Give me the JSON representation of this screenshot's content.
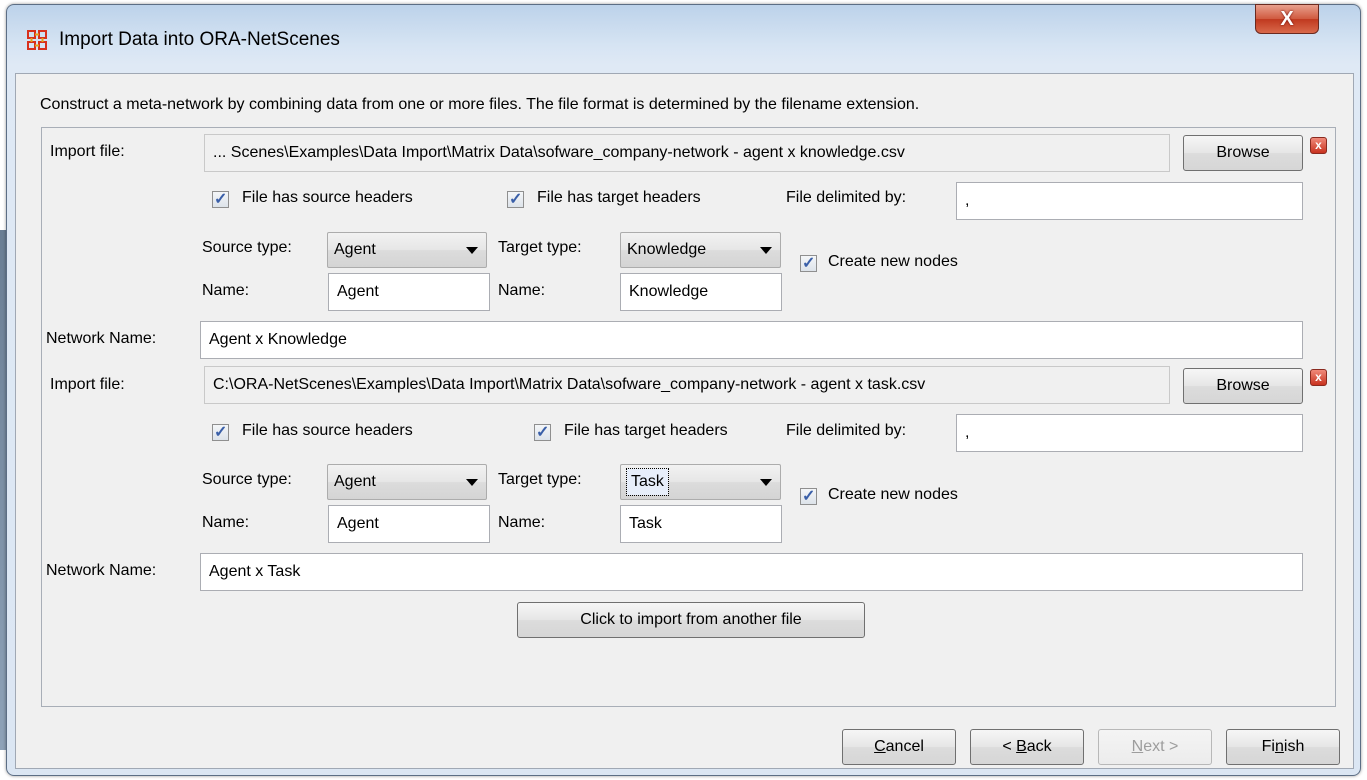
{
  "window": {
    "title": "Import Data into ORA-NetScenes",
    "close_symbol": "X"
  },
  "description": "Construct a meta-network by combining data from one or more files. The file format is determined by the filename extension.",
  "labels": {
    "import_file": "Import file:",
    "browse": "Browse",
    "source_headers": "File has source headers",
    "target_headers": "File has target headers",
    "delimited_by": "File delimited by:",
    "source_type": "Source type:",
    "target_type": "Target type:",
    "name": "Name:",
    "create_nodes": "Create new nodes",
    "network_name": "Network Name:",
    "remove_symbol": "x"
  },
  "imports": [
    {
      "file_path": "... Scenes\\Examples\\Data Import\\Matrix Data\\sofware_company-network - agent x knowledge.csv",
      "source_headers": true,
      "target_headers": true,
      "delimiter": ",",
      "source_type": "Agent",
      "target_type": "Knowledge",
      "source_name": "Agent",
      "target_name": "Knowledge",
      "create_nodes": true,
      "network_name": "Agent x Knowledge"
    },
    {
      "file_path": "C:\\ORA-NetScenes\\Examples\\Data Import\\Matrix Data\\sofware_company-network - agent x task.csv",
      "source_headers": true,
      "target_headers": true,
      "delimiter": ",",
      "source_type": "Agent",
      "target_type": "Task",
      "source_name": "Agent",
      "target_name": "Task",
      "create_nodes": true,
      "network_name": "Agent x Task"
    }
  ],
  "add_file_button": "Click to import from another file",
  "footer": {
    "cancel_first": "C",
    "cancel_rest": "ancel",
    "back_prefix": "< ",
    "back_first": "B",
    "back_rest": "ack",
    "next_first": "N",
    "next_rest": "ext >",
    "finish_prefix": "Fi",
    "finish_mid": "n",
    "finish_rest": "ish"
  },
  "icons": {
    "app": "app-grid-icon",
    "remove": "remove-icon",
    "checkbox": "checkmark-icon",
    "dropdown": "chevron-down-icon"
  },
  "colors": {
    "title_bar": "#d6e4f3",
    "close_button": "#c0391f",
    "dialog_bg": "#f0f0f0",
    "checkmark": "#3a5fa8"
  }
}
